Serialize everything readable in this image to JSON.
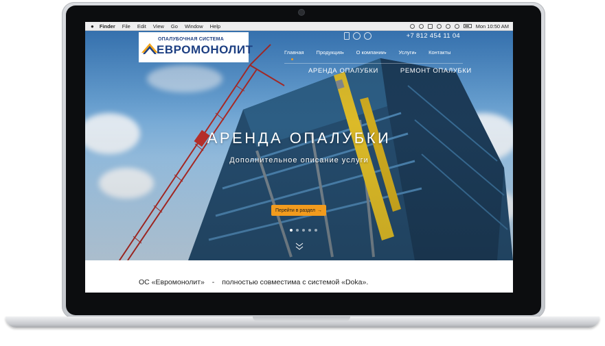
{
  "menubar": {
    "apple": "",
    "items": [
      "Finder",
      "File",
      "Edit",
      "View",
      "Go",
      "Window",
      "Help"
    ],
    "clock": "Mon 10:50 AM"
  },
  "site": {
    "logo_top": "ОПАЛУБОЧНАЯ СИСТЕМА",
    "logo_main": "ЕВРОМОНОЛИТ",
    "phone": "+7 812 454 11 04",
    "nav": [
      "Главная",
      "Продукция",
      "О компании",
      "Услуги",
      "Контакты"
    ],
    "sub_tabs": [
      "АРЕНДА ОПАЛУБКИ",
      "РЕМОНТ ОПАЛУБКИ"
    ]
  },
  "hero": {
    "title": "АРЕНДА ОПАЛУБКИ",
    "subtitle": "Дополнительное описание услуги",
    "cta_label": "Перейти в раздел",
    "cta_arrow": "→",
    "active_slide": 1,
    "slide_count": 5
  },
  "intro": {
    "brand": "ОС «Евромонолит»",
    "dash": "-",
    "text": "полностью совместима с системой «Doka»."
  },
  "colors": {
    "accent": "#f29b1d",
    "brand": "#1d3f82",
    "sky": "#6aa5d8"
  }
}
